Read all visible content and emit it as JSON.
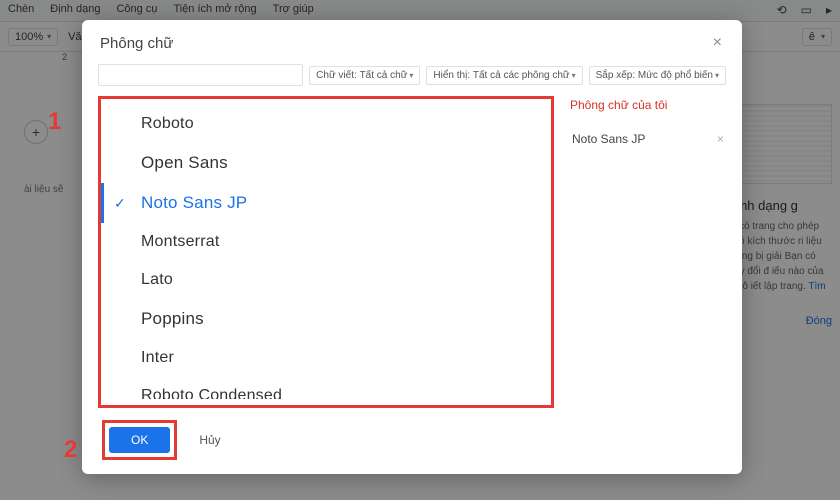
{
  "menubar": {
    "items": [
      "Chèn",
      "Định dạng",
      "Công cụ",
      "Tiện ích mở rộng",
      "Trợ giúp"
    ]
  },
  "toolbar": {
    "zoom": "100%",
    "left_truncated": "Vă",
    "right_label": "ê"
  },
  "ruler_mark": "2",
  "left_gutter": {
    "plus": "+",
    "label": "ài liệu sẽ"
  },
  "sidepanel": {
    "title": "iệu định dạng g",
    "body": "không có trang cho phép bảng có kích thước ri liệu mà không bị giải Bạn có thể thay đổi đ iếu nào của mình thô",
    "link_prefix": "iết lập trang.",
    "link": "Tìm hiểu",
    "close": "Đóng"
  },
  "modal": {
    "title": "Phông chữ",
    "close_glyph": "×",
    "filters": {
      "script_label": "Chữ viết:",
      "script_value": "Tất cả chữ",
      "show_label": "Hiển thị:",
      "show_value": "Tất cả các phông chữ",
      "sort_label": "Sắp xếp:",
      "sort_value": "Mức độ phổ biến"
    },
    "search_placeholder": "",
    "fonts": [
      {
        "name": "Roboto",
        "class": "f-roboto",
        "selected": false
      },
      {
        "name": "Open Sans",
        "class": "f-opensans",
        "selected": false
      },
      {
        "name": "Noto Sans JP",
        "class": "f-noto",
        "selected": true
      },
      {
        "name": "Montserrat",
        "class": "f-mont",
        "selected": false
      },
      {
        "name": "Lato",
        "class": "f-lato",
        "selected": false
      },
      {
        "name": "Poppins",
        "class": "f-poppins",
        "selected": false
      },
      {
        "name": "Inter",
        "class": "f-inter",
        "selected": false
      },
      {
        "name": "Roboto Condensed",
        "class": "f-robotocond",
        "selected": false
      }
    ],
    "myfonts": {
      "title": "Phông chữ của tôi",
      "items": [
        "Noto Sans JP"
      ]
    },
    "buttons": {
      "ok": "OK",
      "cancel": "Hủy"
    }
  },
  "annotations": {
    "one": "1",
    "two": "2"
  }
}
